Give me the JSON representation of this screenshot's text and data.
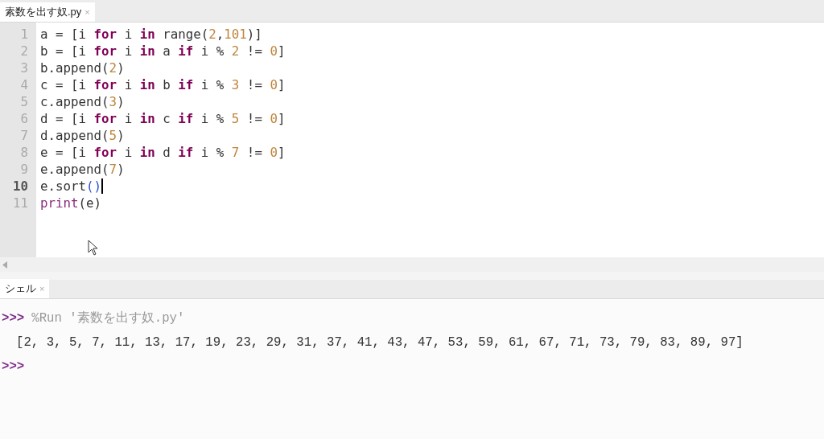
{
  "editor_tabs": [
    {
      "label": "素数を出す奴.py",
      "close": "×",
      "selected": true
    }
  ],
  "editor": {
    "lines": [
      {
        "number": "1",
        "current": false,
        "cursor": false,
        "tokens": [
          {
            "kind": "text",
            "text": "a = [i "
          },
          {
            "kind": "keyword",
            "text": "for"
          },
          {
            "kind": "text",
            "text": " i "
          },
          {
            "kind": "keyword",
            "text": "in"
          },
          {
            "kind": "text",
            "text": " range("
          },
          {
            "kind": "number",
            "text": "2"
          },
          {
            "kind": "text",
            "text": ","
          },
          {
            "kind": "number",
            "text": "101"
          },
          {
            "kind": "text",
            "text": ")]"
          }
        ]
      },
      {
        "number": "2",
        "current": false,
        "cursor": false,
        "tokens": [
          {
            "kind": "text",
            "text": "b = [i "
          },
          {
            "kind": "keyword",
            "text": "for"
          },
          {
            "kind": "text",
            "text": " i "
          },
          {
            "kind": "keyword",
            "text": "in"
          },
          {
            "kind": "text",
            "text": " a "
          },
          {
            "kind": "keyword",
            "text": "if"
          },
          {
            "kind": "text",
            "text": " i % "
          },
          {
            "kind": "number",
            "text": "2"
          },
          {
            "kind": "text",
            "text": " != "
          },
          {
            "kind": "number",
            "text": "0"
          },
          {
            "kind": "text",
            "text": "]"
          }
        ]
      },
      {
        "number": "3",
        "current": false,
        "cursor": false,
        "tokens": [
          {
            "kind": "text",
            "text": "b.append("
          },
          {
            "kind": "number",
            "text": "2"
          },
          {
            "kind": "text",
            "text": ")"
          }
        ]
      },
      {
        "number": "4",
        "current": false,
        "cursor": false,
        "tokens": [
          {
            "kind": "text",
            "text": "c = [i "
          },
          {
            "kind": "keyword",
            "text": "for"
          },
          {
            "kind": "text",
            "text": " i "
          },
          {
            "kind": "keyword",
            "text": "in"
          },
          {
            "kind": "text",
            "text": " b "
          },
          {
            "kind": "keyword",
            "text": "if"
          },
          {
            "kind": "text",
            "text": " i % "
          },
          {
            "kind": "number",
            "text": "3"
          },
          {
            "kind": "text",
            "text": " != "
          },
          {
            "kind": "number",
            "text": "0"
          },
          {
            "kind": "text",
            "text": "]"
          }
        ]
      },
      {
        "number": "5",
        "current": false,
        "cursor": false,
        "tokens": [
          {
            "kind": "text",
            "text": "c.append("
          },
          {
            "kind": "number",
            "text": "3"
          },
          {
            "kind": "text",
            "text": ")"
          }
        ]
      },
      {
        "number": "6",
        "current": false,
        "cursor": false,
        "tokens": [
          {
            "kind": "text",
            "text": "d = [i "
          },
          {
            "kind": "keyword",
            "text": "for"
          },
          {
            "kind": "text",
            "text": " i "
          },
          {
            "kind": "keyword",
            "text": "in"
          },
          {
            "kind": "text",
            "text": " c "
          },
          {
            "kind": "keyword",
            "text": "if"
          },
          {
            "kind": "text",
            "text": " i % "
          },
          {
            "kind": "number",
            "text": "5"
          },
          {
            "kind": "text",
            "text": " != "
          },
          {
            "kind": "number",
            "text": "0"
          },
          {
            "kind": "text",
            "text": "]"
          }
        ]
      },
      {
        "number": "7",
        "current": false,
        "cursor": false,
        "tokens": [
          {
            "kind": "text",
            "text": "d.append("
          },
          {
            "kind": "number",
            "text": "5"
          },
          {
            "kind": "text",
            "text": ")"
          }
        ]
      },
      {
        "number": "8",
        "current": false,
        "cursor": false,
        "tokens": [
          {
            "kind": "text",
            "text": "e = [i "
          },
          {
            "kind": "keyword",
            "text": "for"
          },
          {
            "kind": "text",
            "text": " i "
          },
          {
            "kind": "keyword",
            "text": "in"
          },
          {
            "kind": "text",
            "text": " d "
          },
          {
            "kind": "keyword",
            "text": "if"
          },
          {
            "kind": "text",
            "text": " i % "
          },
          {
            "kind": "number",
            "text": "7"
          },
          {
            "kind": "text",
            "text": " != "
          },
          {
            "kind": "number",
            "text": "0"
          },
          {
            "kind": "text",
            "text": "]"
          }
        ]
      },
      {
        "number": "9",
        "current": false,
        "cursor": false,
        "tokens": [
          {
            "kind": "text",
            "text": "e.append("
          },
          {
            "kind": "number",
            "text": "7"
          },
          {
            "kind": "text",
            "text": ")"
          }
        ]
      },
      {
        "number": "10",
        "current": true,
        "cursor": true,
        "tokens": [
          {
            "kind": "text",
            "text": "e.sort"
          },
          {
            "kind": "bracket",
            "text": "()"
          }
        ]
      },
      {
        "number": "11",
        "current": false,
        "cursor": false,
        "tokens": [
          {
            "kind": "builtin",
            "text": "print"
          },
          {
            "kind": "text",
            "text": "(e)"
          }
        ]
      }
    ]
  },
  "shell_tabs": [
    {
      "label": "シェル",
      "close": "×",
      "selected": true
    }
  ],
  "shell": {
    "lines": [
      {
        "kind": "command",
        "prompt": ">>>",
        "text": "%Run '素数を出す奴.py'"
      },
      {
        "kind": "output",
        "text": "[2, 3, 5, 7, 11, 13, 17, 19, 23, 29, 31, 37, 41, 43, 47, 53, 59, 61, 67, 71, 73, 79, 83, 89, 97]"
      },
      {
        "kind": "prompt",
        "prompt": ">>>"
      }
    ]
  }
}
